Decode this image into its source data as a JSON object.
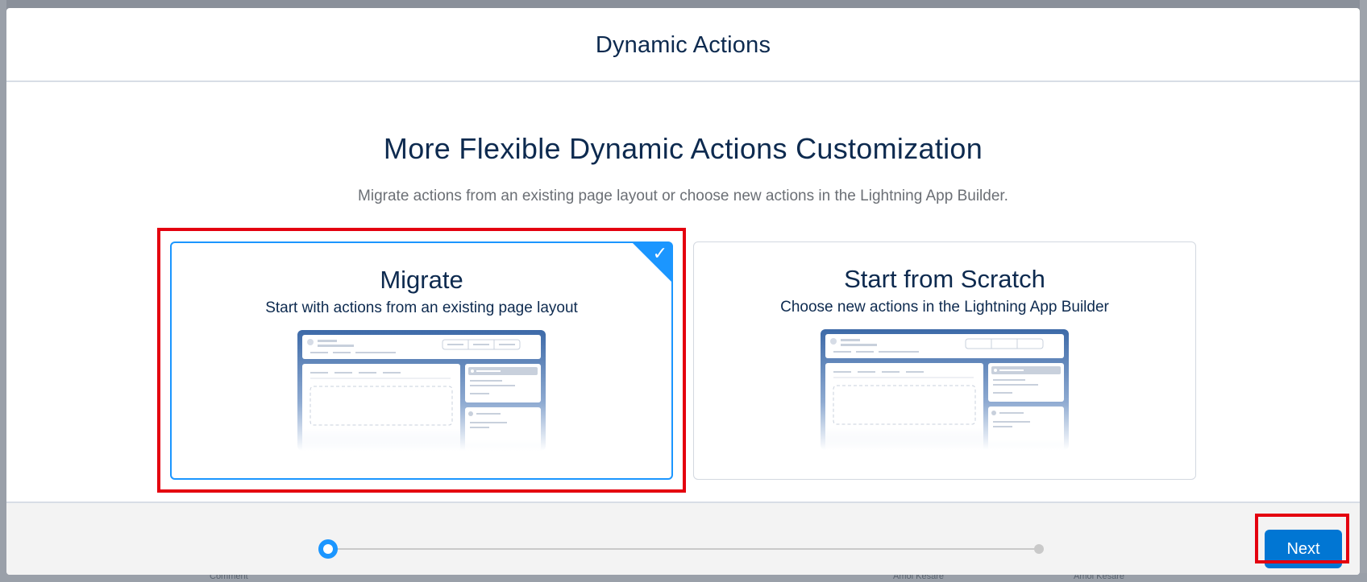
{
  "modal": {
    "title": "Dynamic Actions",
    "headline": "More Flexible Dynamic Actions Customization",
    "subtitle": "Migrate actions from an existing page layout or choose new actions in the Lightning App Builder."
  },
  "options": [
    {
      "title": "Migrate",
      "description": "Start with actions from an existing page layout",
      "selected": true
    },
    {
      "title": "Start from Scratch",
      "description": "Choose new actions in the Lightning App Builder",
      "selected": false
    }
  ],
  "footer": {
    "next_label": "Next",
    "progress": {
      "current_step": 1,
      "total_steps": 2
    }
  },
  "colors": {
    "accent": "#1b96ff",
    "button": "#0176d3",
    "highlight": "#e4000f",
    "title_text": "#0d2a4f"
  },
  "background": {
    "visible_text": [
      "Comment",
      "Amol Kesare",
      "Amol Kesare"
    ]
  }
}
